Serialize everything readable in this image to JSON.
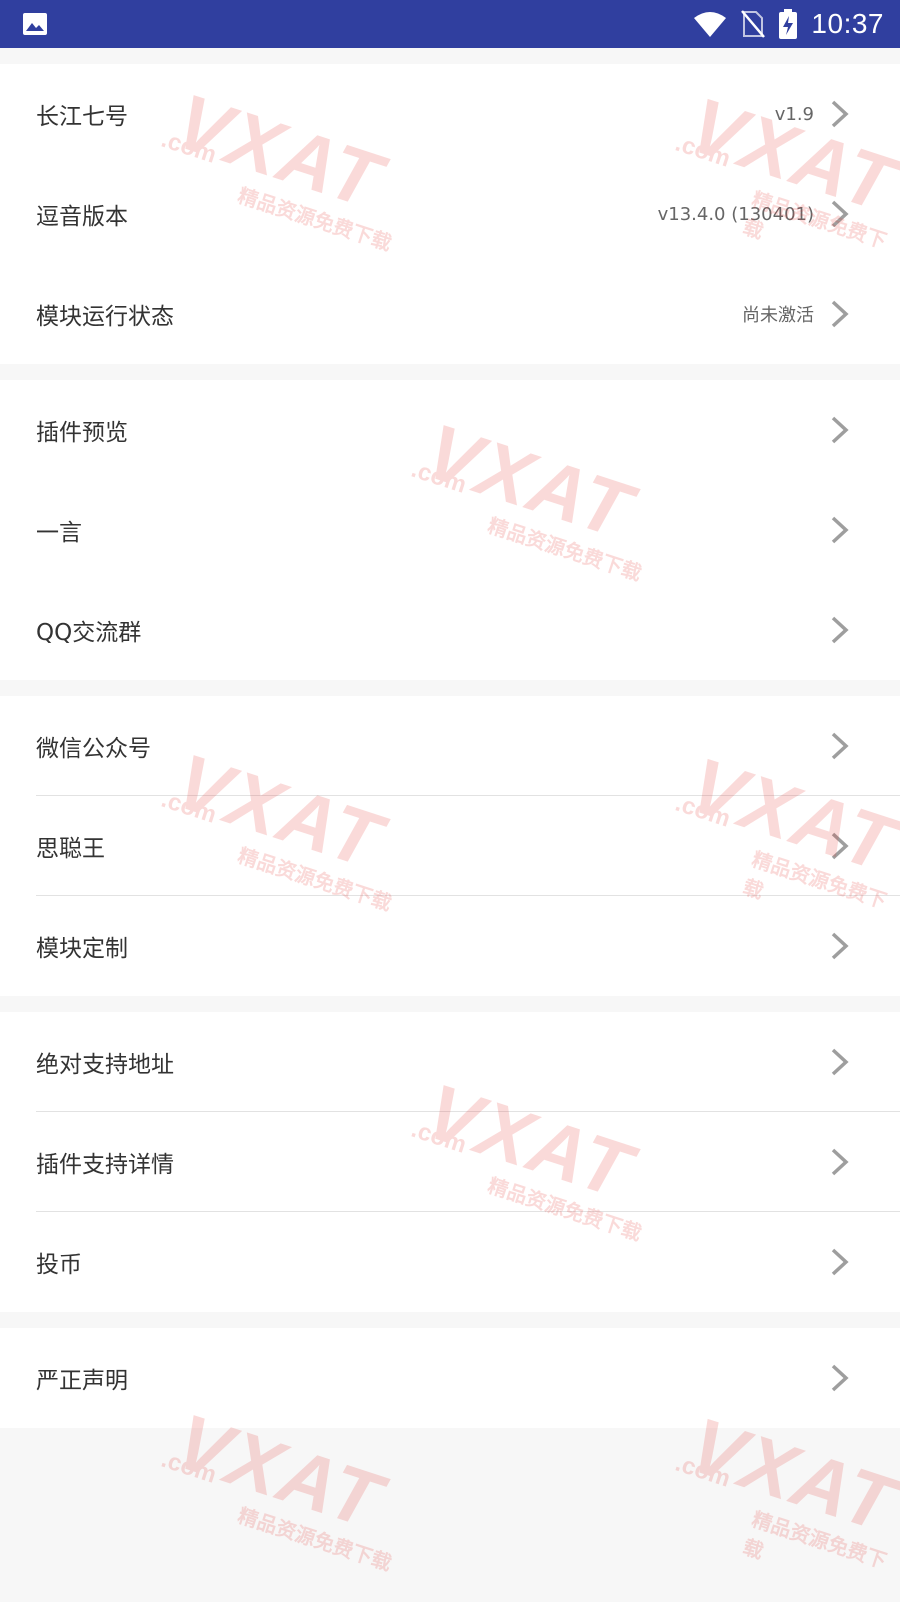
{
  "status_bar": {
    "time": "10:37",
    "icons": [
      "image-notification-icon",
      "wifi-icon",
      "no-sim-icon",
      "battery-charging-icon"
    ]
  },
  "groups": [
    {
      "items": [
        {
          "label": "长江七号",
          "value": "v1.9"
        },
        {
          "label": "逗音版本",
          "value": "v13.4.0 (130401)"
        },
        {
          "label": "模块运行状态",
          "value": "尚未激活"
        }
      ]
    },
    {
      "items": [
        {
          "label": "插件预览",
          "value": ""
        },
        {
          "label": "一言",
          "value": ""
        },
        {
          "label": "QQ交流群",
          "value": ""
        }
      ]
    },
    {
      "items": [
        {
          "label": "微信公众号",
          "value": ""
        },
        {
          "label": "思聪王",
          "value": ""
        },
        {
          "label": "模块定制",
          "value": ""
        }
      ]
    },
    {
      "items": [
        {
          "label": "绝对支持地址",
          "value": ""
        },
        {
          "label": "插件支持详情",
          "value": ""
        },
        {
          "label": "投币",
          "value": ""
        }
      ]
    },
    {
      "items": [
        {
          "label": "严正声明",
          "value": ""
        }
      ]
    }
  ],
  "watermark": {
    "main": "VXAT",
    "com": ".com",
    "sub": "精品资源免费下载"
  },
  "colors": {
    "status_bar": "#303f9f",
    "group_background": "#ffffff",
    "page_background": "#f7f7f7",
    "chevron": "#9e9e9e"
  }
}
